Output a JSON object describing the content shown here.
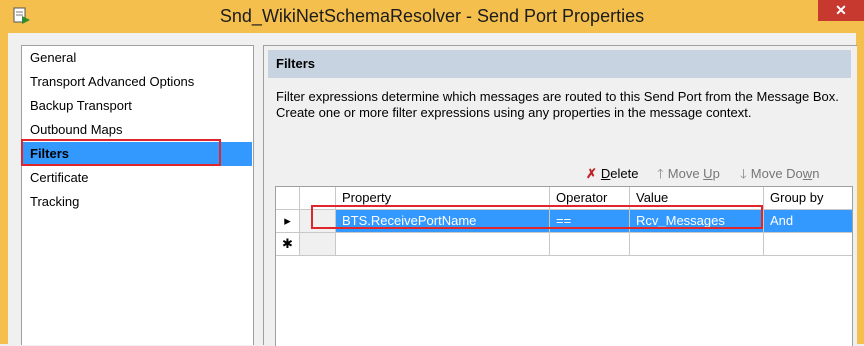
{
  "window": {
    "title": "Snd_WikiNetSchemaResolver - Send Port Properties",
    "close_glyph": "✕",
    "accent_color": "#f4bf4d"
  },
  "nav": {
    "items": [
      {
        "label": "General"
      },
      {
        "label": "Transport Advanced Options"
      },
      {
        "label": "Backup Transport"
      },
      {
        "label": "Outbound Maps"
      },
      {
        "label": "Filters",
        "selected": true
      },
      {
        "label": "Certificate"
      },
      {
        "label": "Tracking"
      }
    ]
  },
  "filters": {
    "header": "Filters",
    "description": "Filter expressions determine which messages are routed to this Send Port from the Message Box. Create one or more filter expressions using any properties in the message context.",
    "toolbar": {
      "delete": {
        "icon": "✗",
        "prefix": "",
        "hot": "D",
        "rest": "elete"
      },
      "move_up": {
        "icon": "🡑",
        "prefix": "Move ",
        "hot": "U",
        "rest": "p"
      },
      "move_down": {
        "icon": "🡓",
        "prefix": "Move Do",
        "hot": "w",
        "rest": "n"
      }
    },
    "grid": {
      "columns": [
        "Property",
        "Operator",
        "Value",
        "Group by"
      ],
      "rows": [
        {
          "marker": "▸",
          "property": "BTS.ReceivePortName",
          "operator": "==",
          "value": "Rcv_Messages",
          "group_by": "And"
        }
      ],
      "new_row_marker": "✱"
    }
  }
}
